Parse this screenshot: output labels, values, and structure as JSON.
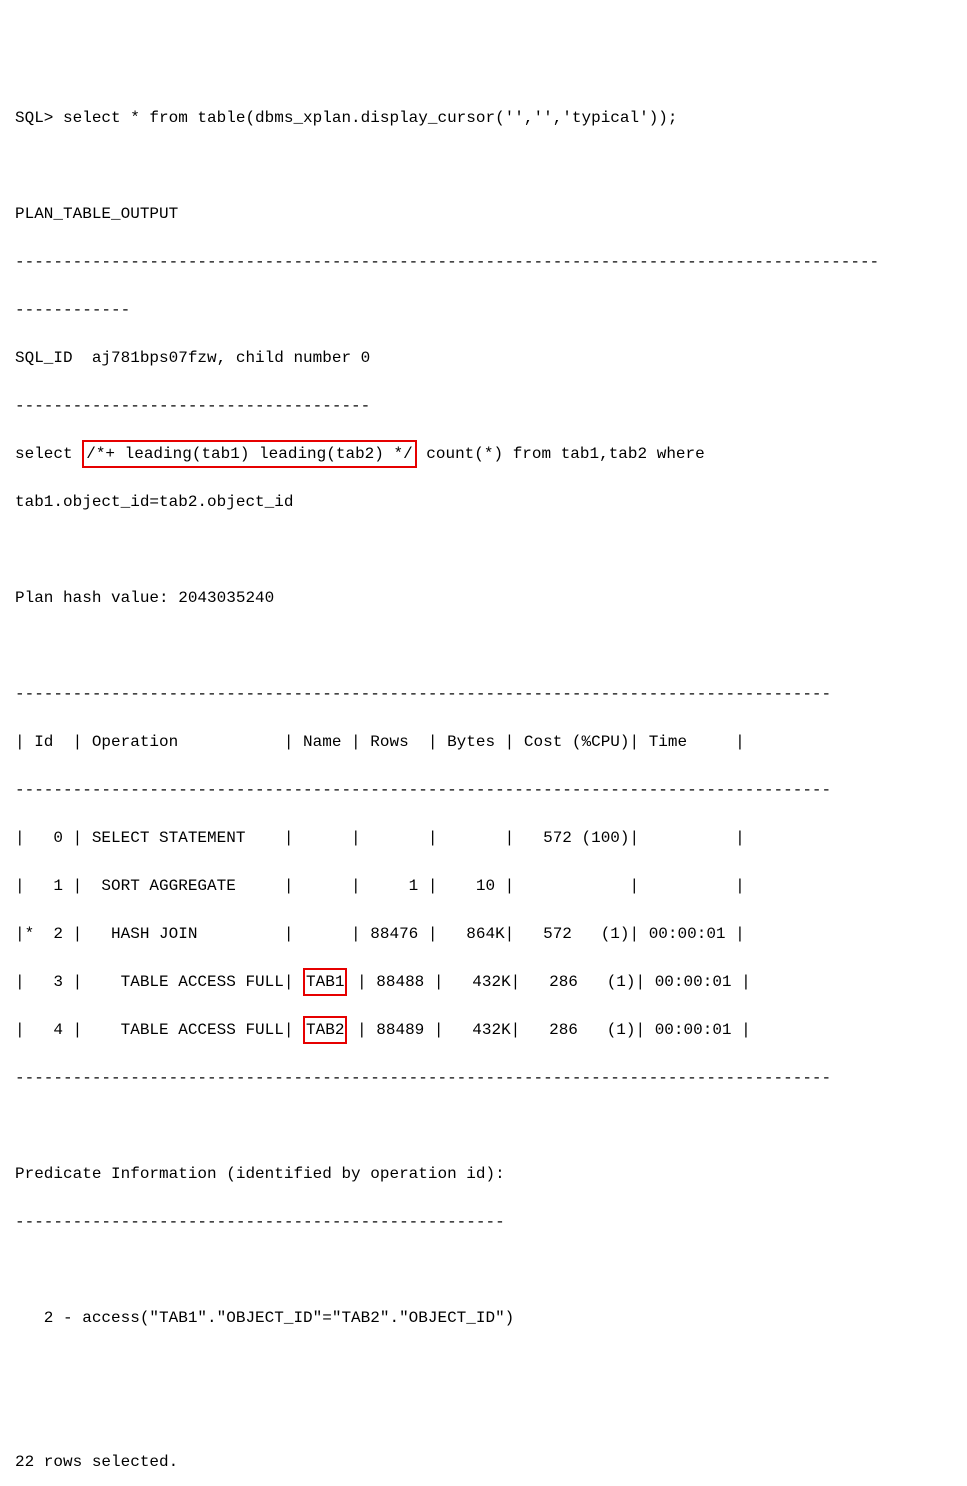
{
  "prompt_line": "SQL> select * from table(dbms_xplan.display_cursor('','','typical'));",
  "header": "PLAN_TABLE_OUTPUT",
  "dash_long": "------------------------------------------------------------------------------------------",
  "dash_short": "------------",
  "sql_id_line": "SQL_ID  aj781bps07fzw, child number 0",
  "sql_id_dash": "-------------------------------------",
  "query_pre": "select ",
  "query_hint": "/*+ leading(tab1) leading(tab2) */",
  "query_post": " count(*) from tab1,tab2 where",
  "query_line2": "tab1.object_id=tab2.object_id",
  "plan_hash": "Plan hash value: 2043035240",
  "table_border": "-------------------------------------------------------------------------------------",
  "table_header": "| Id  | Operation           | Name | Rows  | Bytes | Cost (%CPU)| Time     |",
  "row0": "|   0 | SELECT STATEMENT    |      |       |       |   572 (100)|          |",
  "row1": "|   1 |  SORT AGGREGATE     |      |     1 |    10 |            |          |",
  "row2": "|*  2 |   HASH JOIN         |      | 88476 |   864K|   572   (1)| 00:00:01 |",
  "row3_pre": "|   3 |    TABLE ACCESS FULL| ",
  "row3_name": "TAB1",
  "row3_post": " | 88488 |   432K|   286   (1)| 00:00:01 |",
  "row4_pre": "|   4 |    TABLE ACCESS FULL| ",
  "row4_name": "TAB2",
  "row4_post": " | 88489 |   432K|   286   (1)| 00:00:01 |",
  "pred_title": "Predicate Information (identified by operation id):",
  "pred_dash": "---------------------------------------------------",
  "pred_line": "   2 - access(\"TAB1\".\"OBJECT_ID\"=\"TAB2\".\"OBJECT_ID\")",
  "rows_selected": "22 rows selected."
}
